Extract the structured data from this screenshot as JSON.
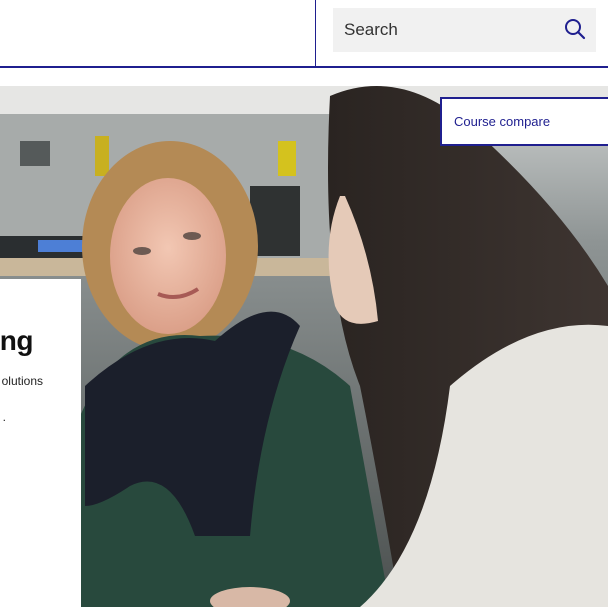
{
  "header": {
    "search": {
      "placeholder": "Search",
      "icon": "search-icon"
    }
  },
  "hero": {
    "course_compare_label": "Course compare",
    "card": {
      "title_fragment": "ng",
      "line1_fragment": "olutions",
      "line2_fragment": "."
    }
  },
  "colors": {
    "brand_navy": "#1f1f8f",
    "search_bg": "#f1f1f1"
  }
}
